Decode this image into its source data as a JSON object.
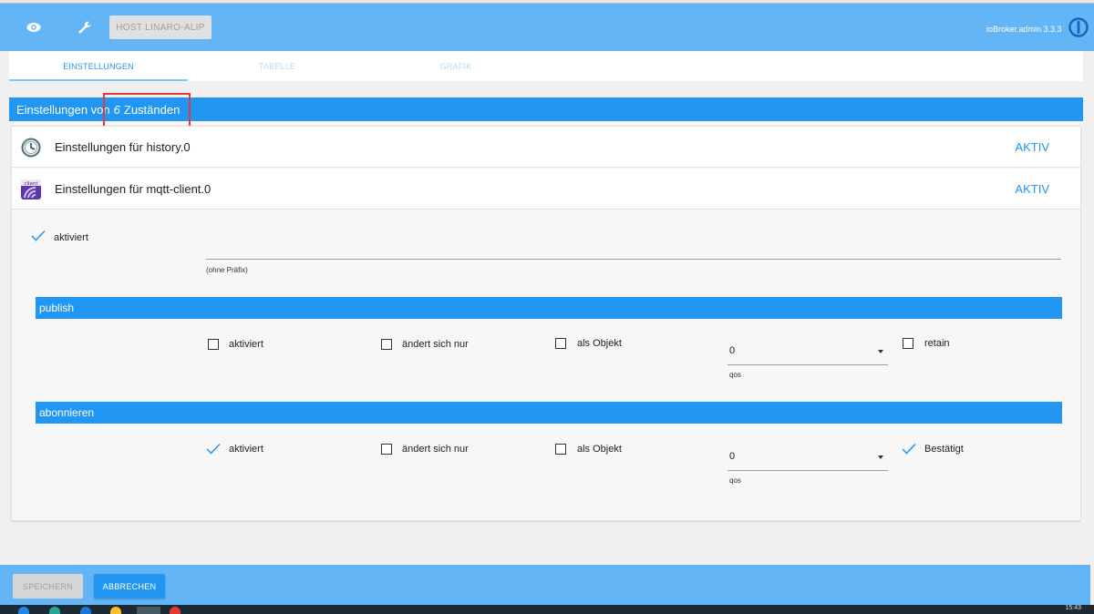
{
  "header": {
    "host_button": "HOST LINARO-ALIP",
    "version": "ioBroker.admin 3.3.3"
  },
  "tabs": [
    {
      "label": "EINSTELLUNGEN",
      "active": true
    },
    {
      "label": "TABELLE",
      "active": false
    },
    {
      "label": "GRAFIK",
      "active": false
    }
  ],
  "main": {
    "title_prefix": "Einstellungen von",
    "count": "6",
    "title_suffix": "Zuständen"
  },
  "adapters": [
    {
      "title": "Einstellungen für history.0",
      "status": "AKTIV",
      "icon": "history-clock-icon"
    },
    {
      "title": "Einstellungen für mqtt-client.0",
      "status": "AKTIV",
      "icon": "mqtt-client-icon"
    }
  ],
  "mqtt": {
    "enabled_label": "aktiviert",
    "enabled_checked": true,
    "prefix_value": "",
    "prefix_hint": "(ohne Präfix)",
    "publish": {
      "title": "publish",
      "enabled": {
        "label": "aktiviert",
        "checked": false
      },
      "changes_only": {
        "label": "ändert sich nur",
        "checked": false
      },
      "as_object": {
        "label": "als Objekt",
        "checked": false
      },
      "qos_value": "0",
      "qos_label": "qos",
      "retain": {
        "label": "retain",
        "checked": false
      }
    },
    "subscribe": {
      "title": "abonnieren",
      "enabled": {
        "label": "aktiviert",
        "checked": true
      },
      "changes_only": {
        "label": "ändert sich nur",
        "checked": false
      },
      "as_object": {
        "label": "als Objekt",
        "checked": false
      },
      "qos_value": "0",
      "qos_label": "qos",
      "ack": {
        "label": "Bestätigt",
        "checked": true
      }
    }
  },
  "footer": {
    "save_label": "SPEICHERN",
    "cancel_label": "ABBRECHEN"
  },
  "taskbar": {
    "time": "15:43"
  },
  "colors": {
    "header": "#64b5f6",
    "accent": "#2196f3",
    "highlight": "#e53935"
  }
}
